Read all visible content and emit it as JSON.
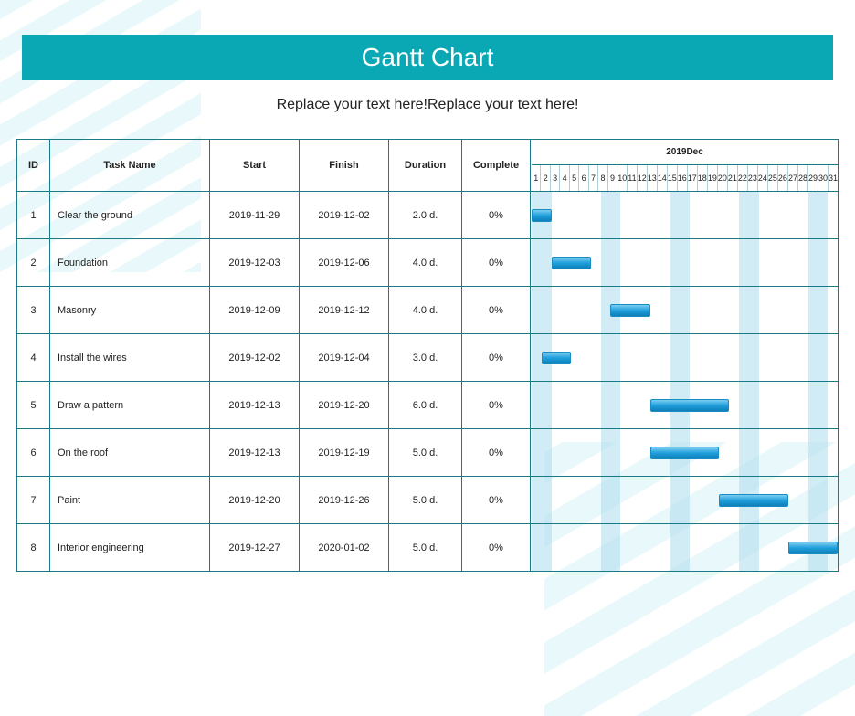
{
  "title": "Gantt Chart",
  "subtitle": "Replace your text here!Replace your text here!",
  "columns": {
    "id": "ID",
    "name": "Task Name",
    "start": "Start",
    "finish": "Finish",
    "duration": "Duration",
    "complete": "Complete"
  },
  "timeline": {
    "month_label": "2019Dec",
    "days": [
      1,
      2,
      3,
      4,
      5,
      6,
      7,
      8,
      9,
      10,
      11,
      12,
      13,
      14,
      15,
      16,
      17,
      18,
      19,
      20,
      21,
      22,
      23,
      24,
      25,
      26,
      27,
      28,
      29,
      30,
      31
    ],
    "weekend_cols": [
      0,
      1,
      7,
      8,
      14,
      15,
      21,
      22,
      28,
      29
    ]
  },
  "tasks": [
    {
      "id": "1",
      "name": "Clear the ground",
      "start": "2019-11-29",
      "finish": "2019-12-02",
      "duration": "2.0 d.",
      "complete": "0%",
      "bar_start": 0,
      "bar_span": 2
    },
    {
      "id": "2",
      "name": "Foundation",
      "start": "2019-12-03",
      "finish": "2019-12-06",
      "duration": "4.0 d.",
      "complete": "0%",
      "bar_start": 2,
      "bar_span": 4
    },
    {
      "id": "3",
      "name": "Masonry",
      "start": "2019-12-09",
      "finish": "2019-12-12",
      "duration": "4.0 d.",
      "complete": "0%",
      "bar_start": 8,
      "bar_span": 4
    },
    {
      "id": "4",
      "name": "Install the wires",
      "start": "2019-12-02",
      "finish": "2019-12-04",
      "duration": "3.0 d.",
      "complete": "0%",
      "bar_start": 1,
      "bar_span": 3
    },
    {
      "id": "5",
      "name": "Draw a pattern",
      "start": "2019-12-13",
      "finish": "2019-12-20",
      "duration": "6.0 d.",
      "complete": "0%",
      "bar_start": 12,
      "bar_span": 8
    },
    {
      "id": "6",
      "name": "On the roof",
      "start": "2019-12-13",
      "finish": "2019-12-19",
      "duration": "5.0 d.",
      "complete": "0%",
      "bar_start": 12,
      "bar_span": 7
    },
    {
      "id": "7",
      "name": "Paint",
      "start": "2019-12-20",
      "finish": "2019-12-26",
      "duration": "5.0 d.",
      "complete": "0%",
      "bar_start": 19,
      "bar_span": 7
    },
    {
      "id": "8",
      "name": "Interior engineering",
      "start": "2019-12-27",
      "finish": "2020-01-02",
      "duration": "5.0 d.",
      "complete": "0%",
      "bar_start": 26,
      "bar_span": 5
    }
  ],
  "chart_data": {
    "type": "bar",
    "title": "Gantt Chart",
    "xlabel": "2019Dec",
    "ylabel": "",
    "x": [
      1,
      2,
      3,
      4,
      5,
      6,
      7,
      8,
      9,
      10,
      11,
      12,
      13,
      14,
      15,
      16,
      17,
      18,
      19,
      20,
      21,
      22,
      23,
      24,
      25,
      26,
      27,
      28,
      29,
      30,
      31
    ],
    "series": [
      {
        "name": "Clear the ground",
        "start": 1,
        "end": 2
      },
      {
        "name": "Foundation",
        "start": 3,
        "end": 6
      },
      {
        "name": "Masonry",
        "start": 9,
        "end": 12
      },
      {
        "name": "Install the wires",
        "start": 2,
        "end": 4
      },
      {
        "name": "Draw a pattern",
        "start": 13,
        "end": 20
      },
      {
        "name": "On the roof",
        "start": 13,
        "end": 19
      },
      {
        "name": "Paint",
        "start": 20,
        "end": 26
      },
      {
        "name": "Interior engineering",
        "start": 27,
        "end": 31
      }
    ],
    "xlim": [
      1,
      31
    ]
  }
}
